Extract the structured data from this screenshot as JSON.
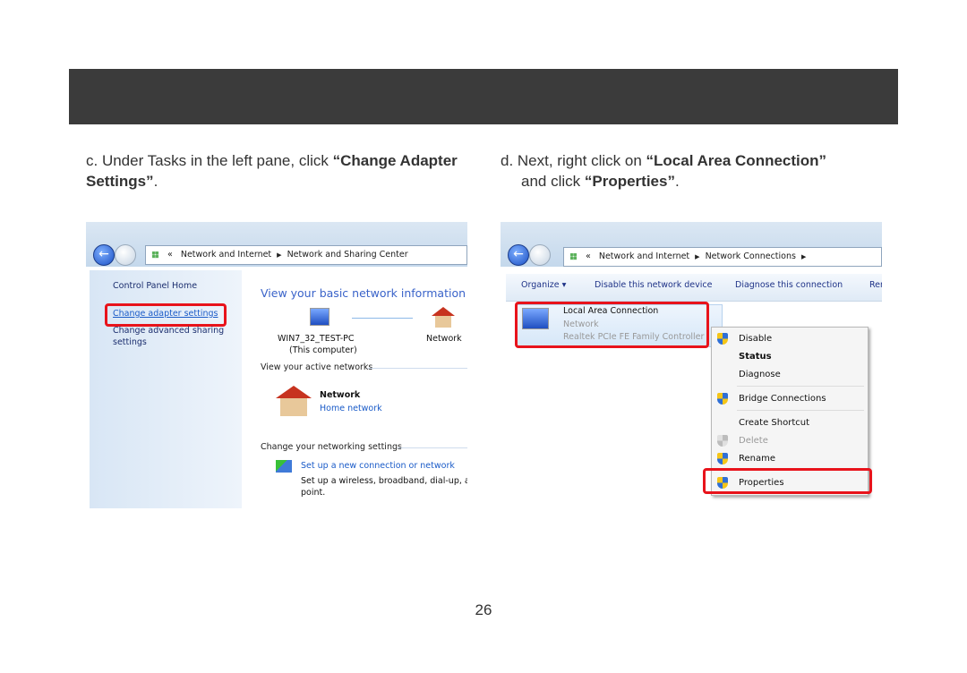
{
  "step_c": {
    "prefix": "c. Under Tasks in the left pane, click ",
    "bold": "“Change Adapter Settings”",
    "suffix": "."
  },
  "step_d": {
    "prefix": "d. Next, right click on ",
    "bold1": "“Local Area Connection”",
    "mid": "and click ",
    "bold2": "“Properties”",
    "suffix": "."
  },
  "left_shot": {
    "breadcrumb": [
      "«",
      "Network and Internet",
      "Network and Sharing Center"
    ],
    "sidebar": [
      "Control Panel Home",
      "Change adapter settings",
      "Change advanced sharing",
      "settings"
    ],
    "title": "View your basic network information ar",
    "computer": "WIN7_32_TEST-PC",
    "computer_sub": "(This computer)",
    "network": "Network",
    "active_heading": "View your active networks",
    "active_name": "Network",
    "active_type": "Home network",
    "change_heading": "Change your networking settings",
    "setup_link": "Set up a new connection or network",
    "setup_desc1": "Set up a wireless, broadband, dial-up, ad h",
    "setup_desc2": "point."
  },
  "right_shot": {
    "breadcrumb": [
      "«",
      "Network and Internet",
      "Network Connections"
    ],
    "toolbar": [
      "Organize ▾",
      "Disable this network device",
      "Diagnose this connection",
      "Ren"
    ],
    "connection": {
      "name": "Local Area Connection",
      "status": "Network",
      "device": "Realtek PCIe FE Family Controller"
    },
    "menu": [
      "Disable",
      "Status",
      "Diagnose",
      "Bridge Connections",
      "Create Shortcut",
      "Delete",
      "Rename",
      "Properties"
    ]
  },
  "page_number": "26",
  "colors": {
    "header": "#3b3b3b",
    "highlight": "#e8131b",
    "link": "#1a5bc8"
  }
}
